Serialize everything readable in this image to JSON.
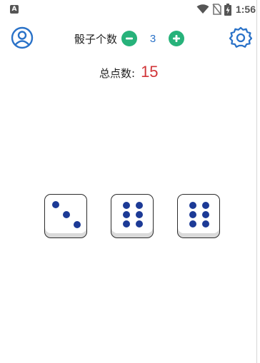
{
  "status_bar": {
    "time": "1:56",
    "app_icon": "A",
    "icons": [
      "wifi-icon",
      "no-sim-icon",
      "battery-charging-icon"
    ]
  },
  "toolbar": {
    "profile_icon": "user-circle-icon",
    "settings_icon": "gear-icon",
    "dice_count_label": "骰子个数",
    "dice_count": "3",
    "decrease_icon": "minus-circle-icon",
    "increase_icon": "plus-circle-icon"
  },
  "total": {
    "label": "总点数:",
    "value": "15"
  },
  "dice": [
    {
      "value": 3
    },
    {
      "value": 6
    },
    {
      "value": 6
    }
  ],
  "colors": {
    "accent_blue": "#2a72c8",
    "stepper_green": "#27b27a",
    "total_red": "#d13438",
    "pip_blue": "#1c3a96"
  }
}
